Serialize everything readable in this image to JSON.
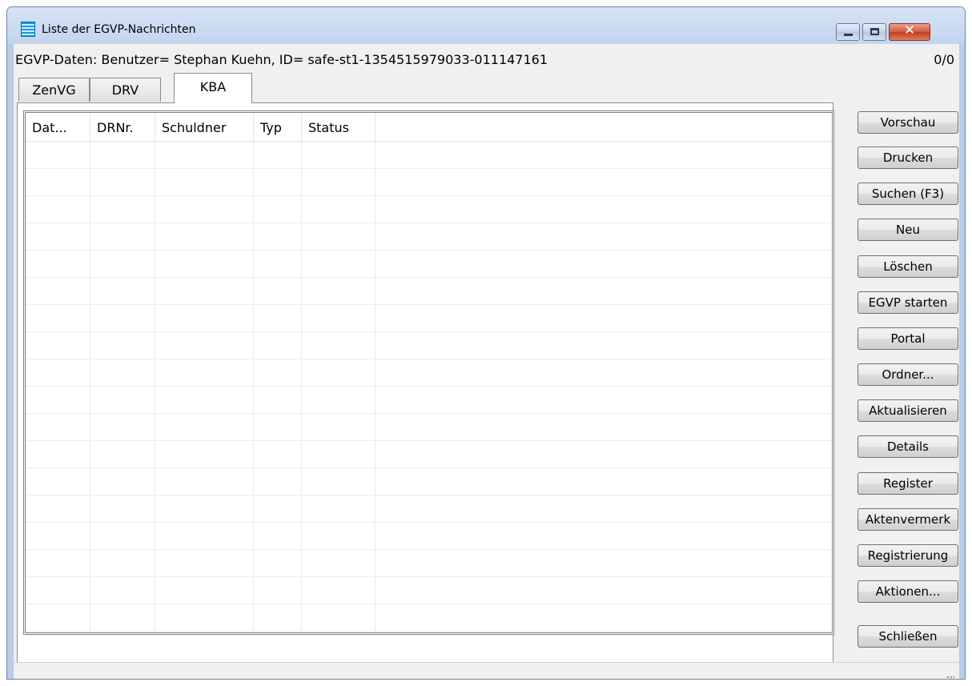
{
  "window": {
    "title": "Liste der EGVP-Nachrichten"
  },
  "info": {
    "text": "EGVP-Daten: Benutzer= Stephan Kuehn, ID= safe-st1-1354515979033-011147161",
    "counter": "0/0"
  },
  "tabs": [
    {
      "label": "ZenVG",
      "selected": false
    },
    {
      "label": "DRV",
      "selected": false
    },
    {
      "label": "KBA",
      "selected": true
    }
  ],
  "table": {
    "columns": [
      "Dat...",
      "DRNr.",
      "Schuldner",
      "Typ",
      "Status"
    ],
    "rows": []
  },
  "buttons": {
    "vorschau": "Vorschau",
    "drucken": "Drucken",
    "suchen": "Suchen (F3)",
    "neu": "Neu",
    "loeschen": "Löschen",
    "egvp_starten": "EGVP starten",
    "portal": "Portal",
    "ordner": "Ordner...",
    "aktualisieren": "Aktualisieren",
    "details": "Details",
    "register": "Register",
    "aktenvermerk": "Aktenvermerk",
    "registrierung": "Registrierung",
    "aktionen": "Aktionen...",
    "schliessen": "Schließen"
  },
  "colors": {
    "titlebar": "#c2d5ee",
    "close_button": "#c23d21",
    "client_bg": "#f0f0f0"
  }
}
